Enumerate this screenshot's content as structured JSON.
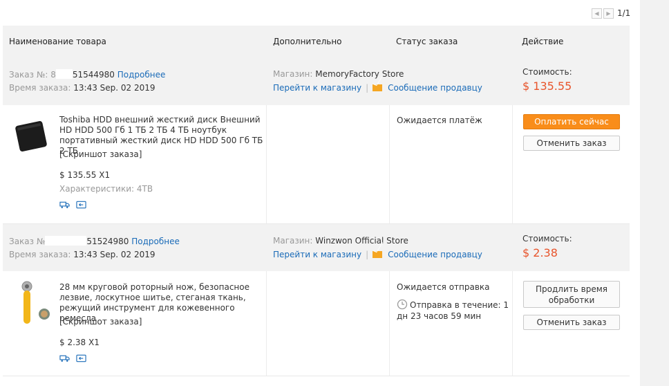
{
  "pager": {
    "text": "1/1"
  },
  "columns": {
    "product": "Наименование товара",
    "extra": "Дополнительно",
    "status": "Статус заказа",
    "action": "Действие"
  },
  "orders": [
    {
      "number_label": "Заказ №:",
      "number_tail": "8",
      "number_end": "51544980",
      "details_link": "Подробнее",
      "time_label": "Время заказа:",
      "time_value": "13:43 Sep. 02 2019",
      "store_label": "Магазин:",
      "store_name": "MemoryFactory Store",
      "store_link": "Перейти к магазину",
      "message_link": "Сообщение продавцу",
      "cost_label": "Стоимость:",
      "cost_value": "$ 135.55",
      "product_title": "Toshiba HDD внешний жесткий диск Внешний HD HDD 500 Гб 1 ТБ 2 ТБ 4 ТБ ноутбук портативный жесткий диск HD HDD 500 Гб ТБ 2 ТБ",
      "snapshot_link": "[Скриншот заказа]",
      "qty_price": "$ 135.55 X1",
      "specs": "Характеристики: 4TB",
      "status": "Ожидается платёж",
      "primary_button": "Оплатить сейчас",
      "secondary_button": "Отменить заказ"
    },
    {
      "number_label": "Заказ №",
      "number_tail": "",
      "number_end": "51524980",
      "details_link": "Подробнее",
      "time_label": "Время заказа:",
      "time_value": "13:43 Sep. 02 2019",
      "store_label": "Магазин:",
      "store_name": "Winzwon Official Store",
      "store_link": "Перейти к магазину",
      "message_link": "Сообщение продавцу",
      "cost_label": "Стоимость:",
      "cost_value": "$ 2.38",
      "product_title": "28 мм круговой роторный нож, безопасное лезвие, лоскутное шитье, стеганая ткань, режущий инструмент для кожевенного ремесла",
      "snapshot_link": "[Скриншот заказа]",
      "qty_price": "$ 2.38 X1",
      "status": "Ожидается отправка",
      "shipping_note": "Отправка в течение: 1 дн 23 часов 59 мин",
      "primary_button": "Продлить время обработки",
      "secondary_button": "Отменить заказ"
    }
  ]
}
